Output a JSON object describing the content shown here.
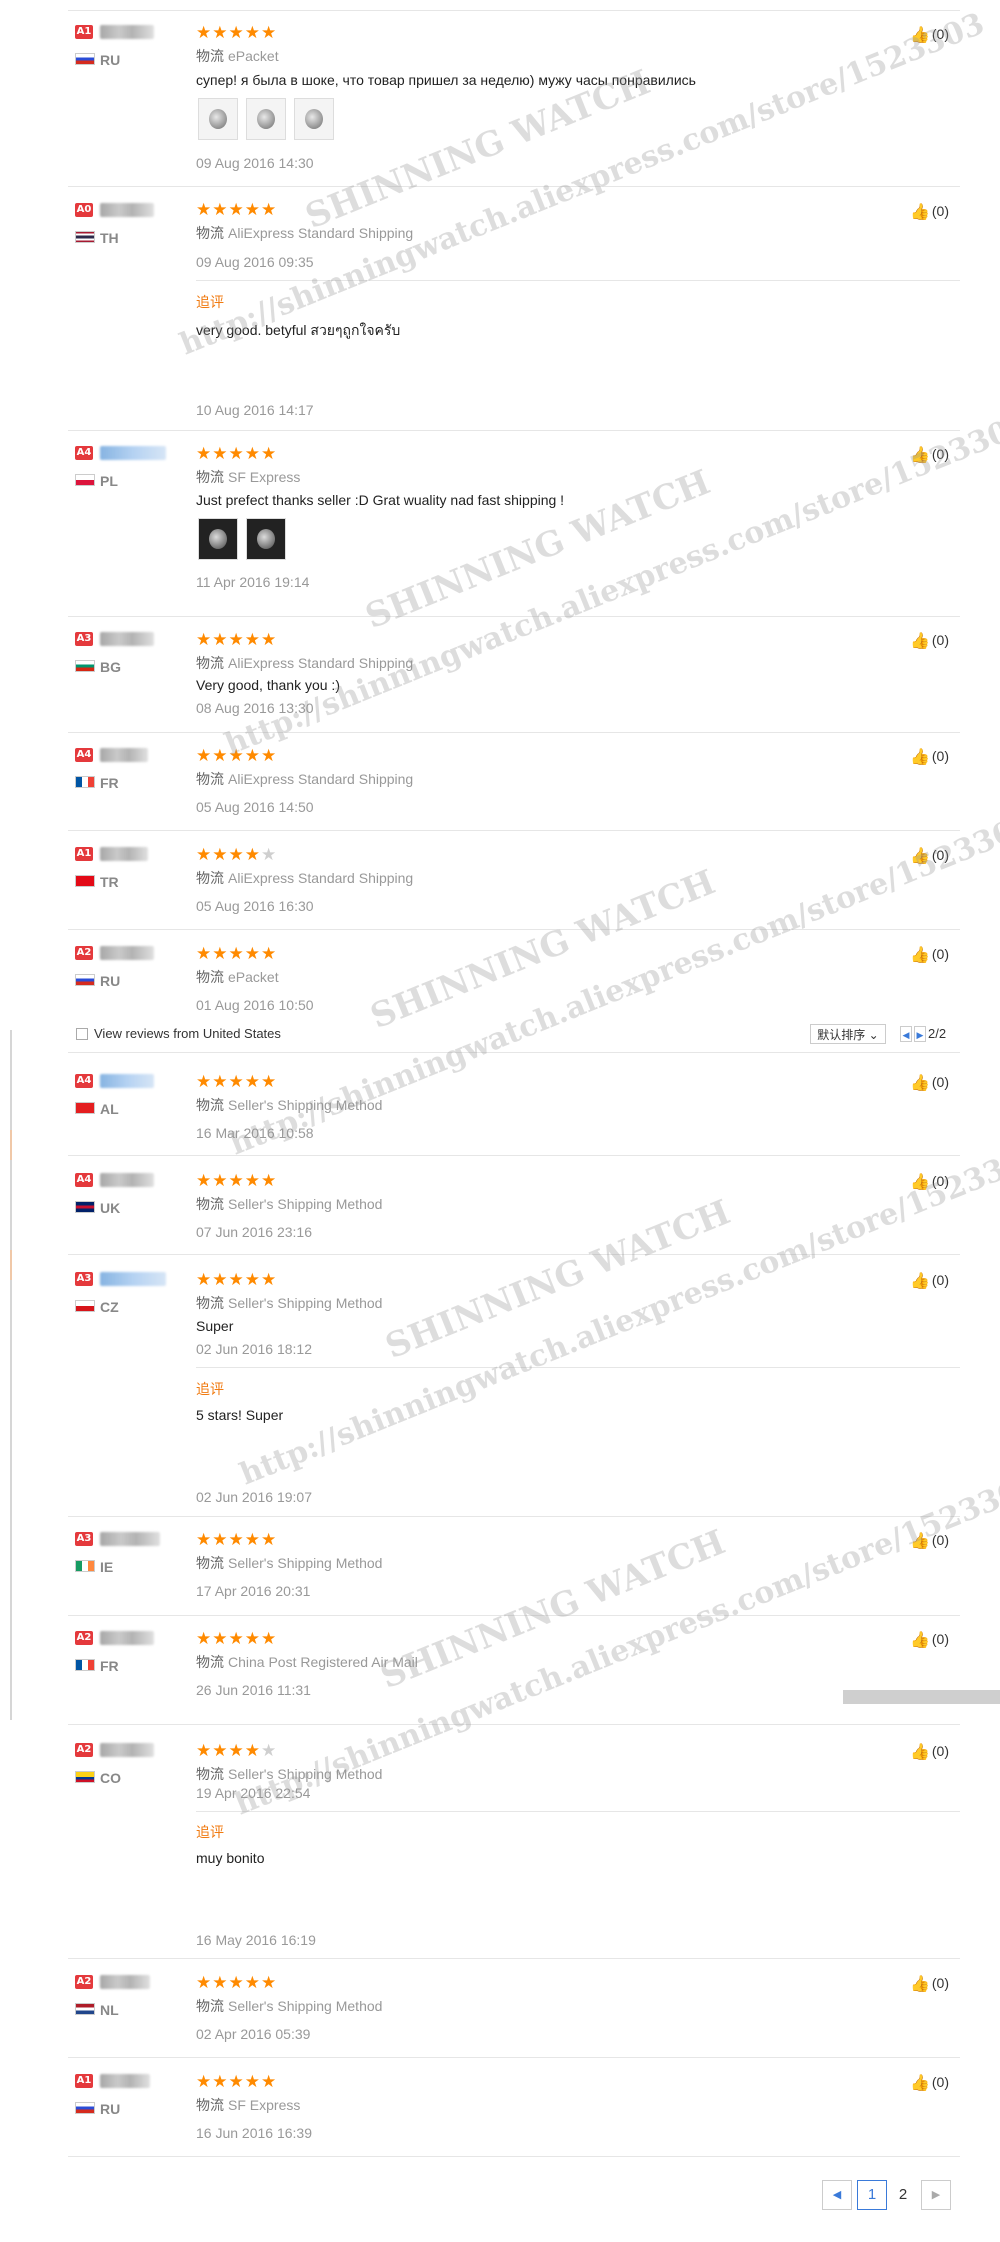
{
  "thumb_glyph": "👍",
  "reviews": [
    {
      "level": "A1",
      "country": "RU",
      "shipping": "ePacket",
      "text": "супер! я была в шоке, что товар пришел за неделю) мужу часы понравились",
      "date": "09 Aug 2016 14:30",
      "likes": "(0)",
      "stars": 5
    },
    {
      "level": "A0",
      "country": "TH",
      "shipping": "AliExpress Standard Shipping",
      "date": "09 Aug 2016 09:35",
      "append_label": "追评",
      "append_text": "very good. betyful สวยๆถูกใจครับ",
      "append_date": "10 Aug 2016 14:17",
      "likes": "(0)",
      "stars": 5
    },
    {
      "level": "A4",
      "country": "PL",
      "shipping": "SF Express",
      "text": "Just prefect thanks seller :D Grat wuality nad fast shipping !",
      "date": "11 Apr 2016 19:14",
      "likes": "(0)",
      "stars": 5
    },
    {
      "level": "A3",
      "country": "BG",
      "shipping": "AliExpress Standard Shipping",
      "text": "Very good, thank you :)",
      "date": "08 Aug 2016 13:30",
      "likes": "(0)",
      "stars": 5
    },
    {
      "level": "A4",
      "country": "FR",
      "shipping": "AliExpress Standard Shipping",
      "date": "05 Aug 2016 14:50",
      "likes": "(0)",
      "stars": 5
    },
    {
      "level": "A1",
      "country": "TR",
      "shipping": "AliExpress Standard Shipping",
      "date": "05 Aug 2016 16:30",
      "likes": "(0)",
      "stars": 4
    },
    {
      "level": "A2",
      "country": "RU",
      "shipping": "ePacket",
      "date": "01 Aug 2016 10:50",
      "likes": "(0)",
      "stars": 5
    },
    {
      "level": "A4",
      "country": "AL",
      "shipping": "Seller's Shipping Method",
      "date": "16 Mar 2016 10:58",
      "likes": "(0)",
      "stars": 5
    },
    {
      "level": "A4",
      "country": "UK",
      "shipping": "Seller's Shipping Method",
      "date": "07 Jun 2016 23:16",
      "likes": "(0)",
      "stars": 5
    },
    {
      "level": "A3",
      "country": "CZ",
      "shipping": "Seller's Shipping Method",
      "text": "Super",
      "date": "02 Jun 2016 18:12",
      "append_label": "追评",
      "append_text": "5 stars! Super",
      "append_date": "02 Jun 2016 19:07",
      "likes": "(0)",
      "stars": 5
    },
    {
      "level": "A3",
      "country": "IE",
      "shipping": "Seller's Shipping Method",
      "date": "17 Apr 2016 20:31",
      "likes": "(0)",
      "stars": 5
    },
    {
      "level": "A2",
      "country": "FR",
      "shipping": "China Post Registered Air Mail",
      "date": "26 Jun 2016 11:31",
      "likes": "(0)",
      "stars": 5
    },
    {
      "level": "A2",
      "country": "CO",
      "shipping": "Seller's Shipping Method",
      "date": "19 Apr 2016 22:54",
      "append_label": "追评",
      "append_text": "muy bonito",
      "append_date": "16 May 2016 16:19",
      "likes": "(0)",
      "stars": 4
    },
    {
      "level": "A2",
      "country": "NL",
      "shipping": "Seller's Shipping Method",
      "date": "02 Apr 2016 05:39",
      "likes": "(0)",
      "stars": 5
    },
    {
      "level": "A1",
      "country": "RU",
      "shipping": "SF Express",
      "date": "16 Jun 2016 16:39",
      "likes": "(0)",
      "stars": 5
    }
  ],
  "shipping_prefix": "物流",
  "filter": {
    "label": "View reviews from United States",
    "sort_label": "默认排序",
    "page_info": "2/2"
  },
  "pager": {
    "prev": "◀",
    "page1": "1",
    "page2": "2",
    "next": "▶"
  },
  "watermark": {
    "brand": "SHINNING WATCH",
    "url": "http://shinningwatch.aliexpress.com/store/1523303"
  },
  "colors": {
    "accent": "#ff8a00",
    "level_badge": "#e4393c",
    "append": "#f07a10",
    "link": "#3a7ad9"
  }
}
